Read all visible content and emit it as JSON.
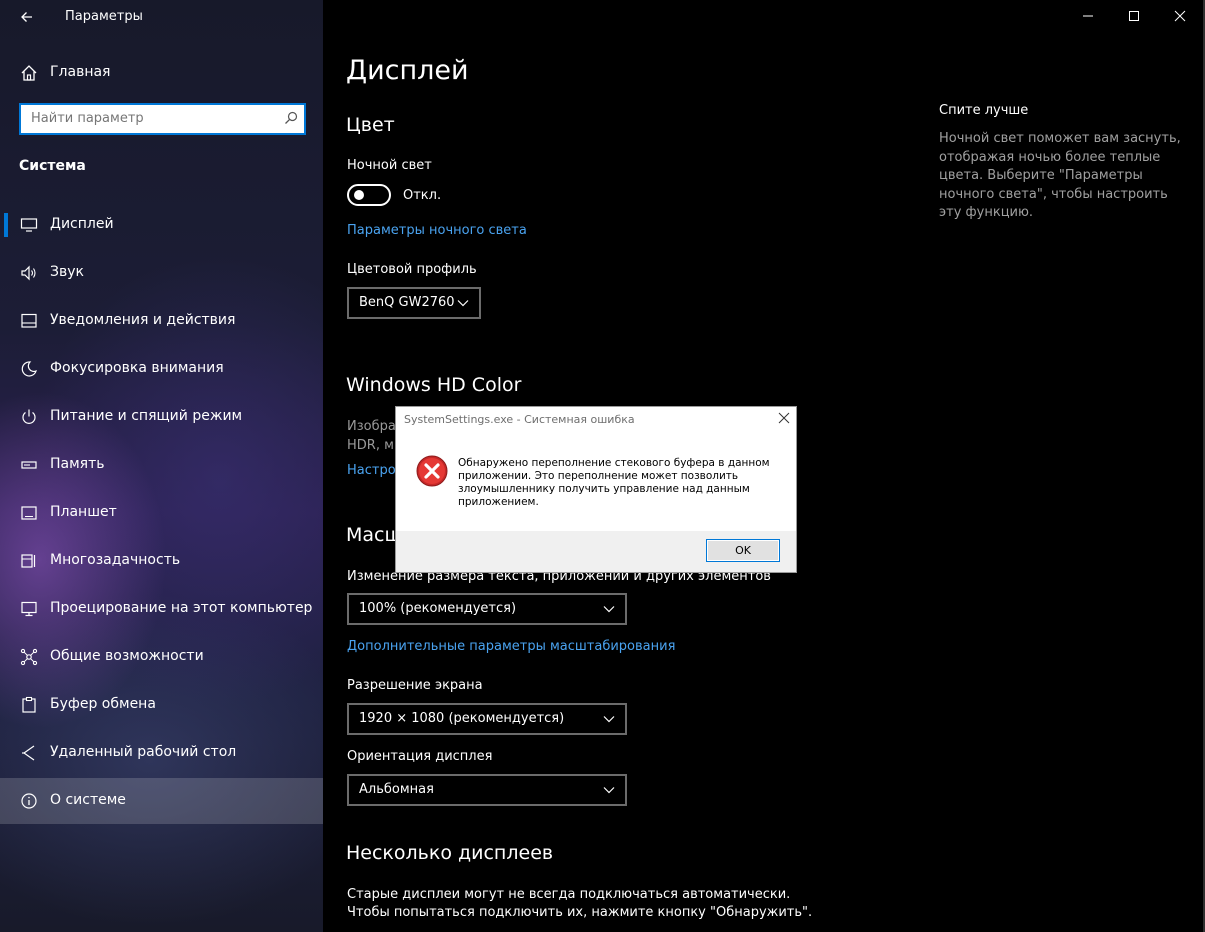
{
  "window": {
    "title": "Параметры"
  },
  "sidebar": {
    "home_label": "Главная",
    "search_placeholder": "Найти параметр",
    "section": "Система",
    "items": [
      {
        "label": "Дисплей",
        "icon": "monitor-icon"
      },
      {
        "label": "Звук",
        "icon": "speaker-icon"
      },
      {
        "label": "Уведомления и действия",
        "icon": "notification-icon"
      },
      {
        "label": "Фокусировка внимания",
        "icon": "moon-icon"
      },
      {
        "label": "Питание и спящий режим",
        "icon": "power-icon"
      },
      {
        "label": "Память",
        "icon": "storage-icon"
      },
      {
        "label": "Планшет",
        "icon": "tablet-icon"
      },
      {
        "label": "Многозадачность",
        "icon": "multitask-icon"
      },
      {
        "label": "Проецирование на этот компьютер",
        "icon": "project-icon"
      },
      {
        "label": "Общие возможности",
        "icon": "shared-icon"
      },
      {
        "label": "Буфер обмена",
        "icon": "clipboard-icon"
      },
      {
        "label": "Удаленный рабочий стол",
        "icon": "remote-desktop-icon"
      },
      {
        "label": "О системе",
        "icon": "info-icon"
      }
    ]
  },
  "main": {
    "title": "Дисплей",
    "color_heading": "Цвет",
    "night_light_label": "Ночной свет",
    "night_light_state": "Откл.",
    "night_light_link": "Параметры ночного света",
    "color_profile_label": "Цветовой профиль",
    "color_profile_value": "BenQ GW2760",
    "hd_heading": "Windows HD Color",
    "hd_text_1": "Изобра",
    "hd_text_2": "HDR, м",
    "hd_link": "Настро",
    "scale_heading": "Масш",
    "scale_label": "Изменение размера текста, приложений и других элементов",
    "scale_value": "100% (рекомендуется)",
    "scale_link": "Дополнительные параметры масштабирования",
    "resolution_label": "Разрешение экрана",
    "resolution_value": "1920 × 1080 (рекомендуется)",
    "orientation_label": "Ориентация дисплея",
    "orientation_value": "Альбомная",
    "multi_heading": "Несколько дисплеев",
    "multi_text_1": "Старые дисплеи могут не всегда подключаться автоматически.",
    "multi_text_2": "Чтобы попытаться подключить их, нажмите кнопку \"Обнаружить\"."
  },
  "aside": {
    "title": "Спите лучше",
    "text": "Ночной свет поможет вам заснуть, отображая ночью более теплые цвета. Выберите \"Параметры ночного света\", чтобы настроить эту функцию."
  },
  "dialog": {
    "title": "SystemSettings.exe - Системная ошибка",
    "message": "Обнаружено переполнение стекового буфера в данном приложении. Это переполнение может позволить злоумышленнику получить управление над данным приложением.",
    "ok_label": "OK",
    "icon": "error-icon"
  },
  "colors": {
    "accent": "#0078d7",
    "link": "#4aa3f0",
    "error_red": "#d32f2f"
  }
}
